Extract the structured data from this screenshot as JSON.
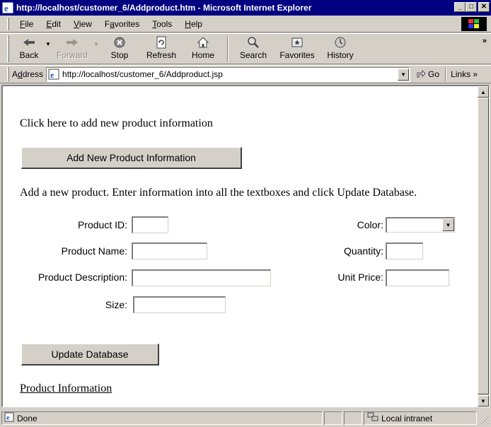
{
  "window": {
    "title": "http://localhost/customer_6/Addproduct.htm - Microsoft Internet Explorer",
    "minimize": "_",
    "maximize": "□",
    "close": "✕"
  },
  "menu": {
    "file": {
      "u": "F",
      "rest": "ile"
    },
    "edit": {
      "u": "E",
      "rest": "dit"
    },
    "view": {
      "u": "V",
      "rest": "iew"
    },
    "favorites": {
      "pre": "F",
      "u": "a",
      "rest": "vorites"
    },
    "tools": {
      "u": "T",
      "rest": "ools"
    },
    "help": {
      "u": "H",
      "rest": "elp"
    }
  },
  "toolbar": {
    "back": "Back",
    "forward": "Forward",
    "stop": "Stop",
    "refresh": "Refresh",
    "home": "Home",
    "search": "Search",
    "favorites": "Favorites",
    "history": "History",
    "more": "»"
  },
  "address": {
    "label_pre": "A",
    "label_u": "d",
    "label_rest": "dress",
    "url": "http://localhost/customer_6/Addproduct.jsp",
    "go": "Go",
    "links": "Links »"
  },
  "page": {
    "intro": "Click here to add new product information",
    "add_button": "Add New Product Information",
    "instructions": "Add a new product. Enter information into all the textboxes and click Update Database.",
    "fields": {
      "product_id": {
        "label": "Product ID:",
        "value": ""
      },
      "product_name": {
        "label": "Product Name:",
        "value": ""
      },
      "product_description": {
        "label": "Product Description:",
        "value": ""
      },
      "size": {
        "label": "Size:",
        "value": ""
      },
      "color": {
        "label": "Color:",
        "value": ""
      },
      "quantity": {
        "label": "Quantity:",
        "value": ""
      },
      "unit_price": {
        "label": "Unit Price:",
        "value": ""
      }
    },
    "update_button": "Update Database",
    "link": "Product Information"
  },
  "status": {
    "text": "Done",
    "zone": "Local intranet"
  }
}
